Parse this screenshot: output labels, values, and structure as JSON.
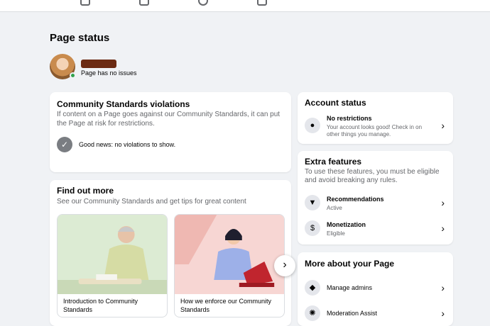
{
  "header": {
    "page_title": "Page status",
    "status_text": "Page has no issues"
  },
  "csv": {
    "title": "Community Standards violations",
    "description": "If content on a Page goes against our Community Standards, it can put the Page at risk for restrictions.",
    "good_news": "Good news: no violations to show."
  },
  "find_out": {
    "title": "Find out more",
    "subtitle": "See our Community Standards and get tips for great content",
    "articles": [
      {
        "caption": "Introduction to Community Standards"
      },
      {
        "caption": "How we enforce our Community Standards"
      }
    ]
  },
  "account_status": {
    "title": "Account status",
    "row_title": "No restrictions",
    "row_sub": "Your account looks good! Check in on other things you manage."
  },
  "extra_features": {
    "title": "Extra features",
    "subtitle": "To use these features, you must be eligible and avoid breaking any rules.",
    "items": [
      {
        "title": "Recommendations",
        "status": "Active"
      },
      {
        "title": "Monetization",
        "status": "Eligible"
      }
    ]
  },
  "more_about": {
    "title": "More about your Page",
    "items": [
      {
        "label": "Manage admins"
      },
      {
        "label": "Moderation Assist"
      }
    ]
  },
  "colors": {
    "background": "#f0f2f5",
    "card": "#ffffff",
    "secondary_text": "#65676b",
    "online": "#31a24c"
  }
}
